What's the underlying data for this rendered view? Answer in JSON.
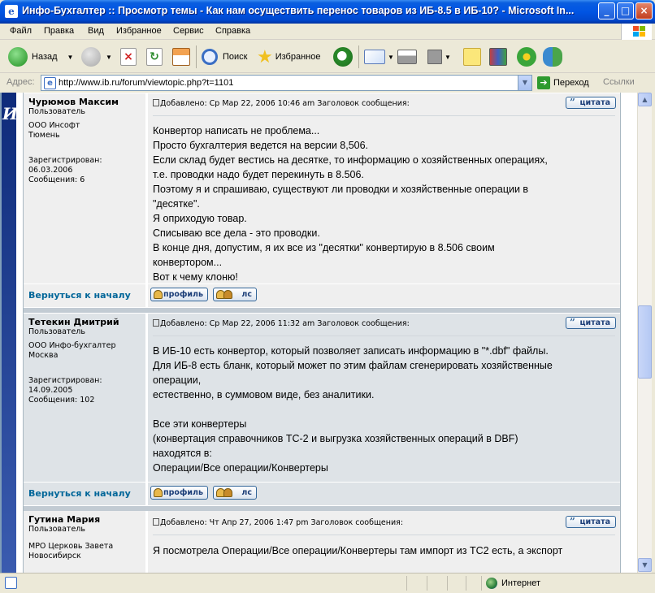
{
  "window": {
    "title": "Инфо-Бухгалтер :: Просмотр темы - Как нам осуществить перенос товаров из ИБ-8.5 в ИБ-10? - Microsoft In..."
  },
  "menu": [
    "Файл",
    "Правка",
    "Вид",
    "Избранное",
    "Сервис",
    "Справка"
  ],
  "toolbar": {
    "back": "Назад",
    "search": "Поиск",
    "favorites": "Избранное"
  },
  "address": {
    "label": "Адрес:",
    "url": "http://www.ib.ru/forum/viewtopic.php?t=1101",
    "go": "Переход",
    "links": "Ссылки"
  },
  "posts": [
    {
      "author": "Чурюмов Максим",
      "role": "Пользователь",
      "org": "ООО Инсофт",
      "city": "Тюмень",
      "registered_label": "Зарегистрирован:",
      "registered": "06.03.2006",
      "messages": "Сообщения: 6",
      "header": "Добавлено: Ср Мар 22, 2006 10:46 am    Заголовок сообщения:",
      "lines": [
        "Конвертор написать не проблема...",
        "Просто бухгалтерия ведется на версии 8,506.",
        "Если склад будет вестись на десятке, то информацию о хозяйственных операциях,",
        "т.е. проводки надо будет перекинуть в 8.506.",
        "Поэтому я и спрашиваю, существуют ли проводки и хозяйственные операции в",
        "\"десятке\".",
        "Я оприходую товар.",
        "Списываю все дела - это проводки.",
        "В конце дня, допустим, я их все из \"десятки\" конвертирую в 8.506 своим",
        "конвертором...",
        "Вот к чему клоню!"
      ]
    },
    {
      "author": "Тетекин Дмитрий",
      "role": "Пользователь",
      "org": "ООО Инфо-бухгалтер",
      "city": "Москва",
      "registered_label": "Зарегистрирован:",
      "registered": "14.09.2005",
      "messages": "Сообщения: 102",
      "header": "Добавлено: Ср Мар 22, 2006 11:32 am    Заголовок сообщения:",
      "lines": [
        "В ИБ-10 есть конвертор, который позволяет записать информацию в \"*.dbf\" файлы.",
        "Для ИБ-8 есть бланк, который может по этим файлам сгенерировать хозяйственные",
        "операции,",
        "естественно, в суммовом виде, без аналитики.",
        "",
        "Все эти конвертеры",
        "(конвертация справочников ТС-2 и выгрузка хозяйственных операций в DBF)",
        "находятся в:",
        "Операции/Все операции/Конвертеры"
      ]
    },
    {
      "author": "Гутина Мария",
      "role": "Пользователь",
      "org": "МРО Церковь Завета",
      "city": "Новосибирск",
      "header": "Добавлено: Чт Апр 27, 2006 1:47 pm    Заголовок сообщения:",
      "lines": [
        "Я посмотрела Операции/Все операции/Конвертеры там импорт из ТС2 есть, а экспорт"
      ]
    }
  ],
  "buttons": {
    "quote": "цитата",
    "profile": "профиль",
    "pm": "лс",
    "back_to_top": "Вернуться к началу"
  },
  "status": {
    "zone": "Интернет"
  },
  "colors": {
    "row1": "#efefef",
    "row2": "#dee3e7",
    "link": "#006699",
    "titlebar": "#0054e3"
  }
}
